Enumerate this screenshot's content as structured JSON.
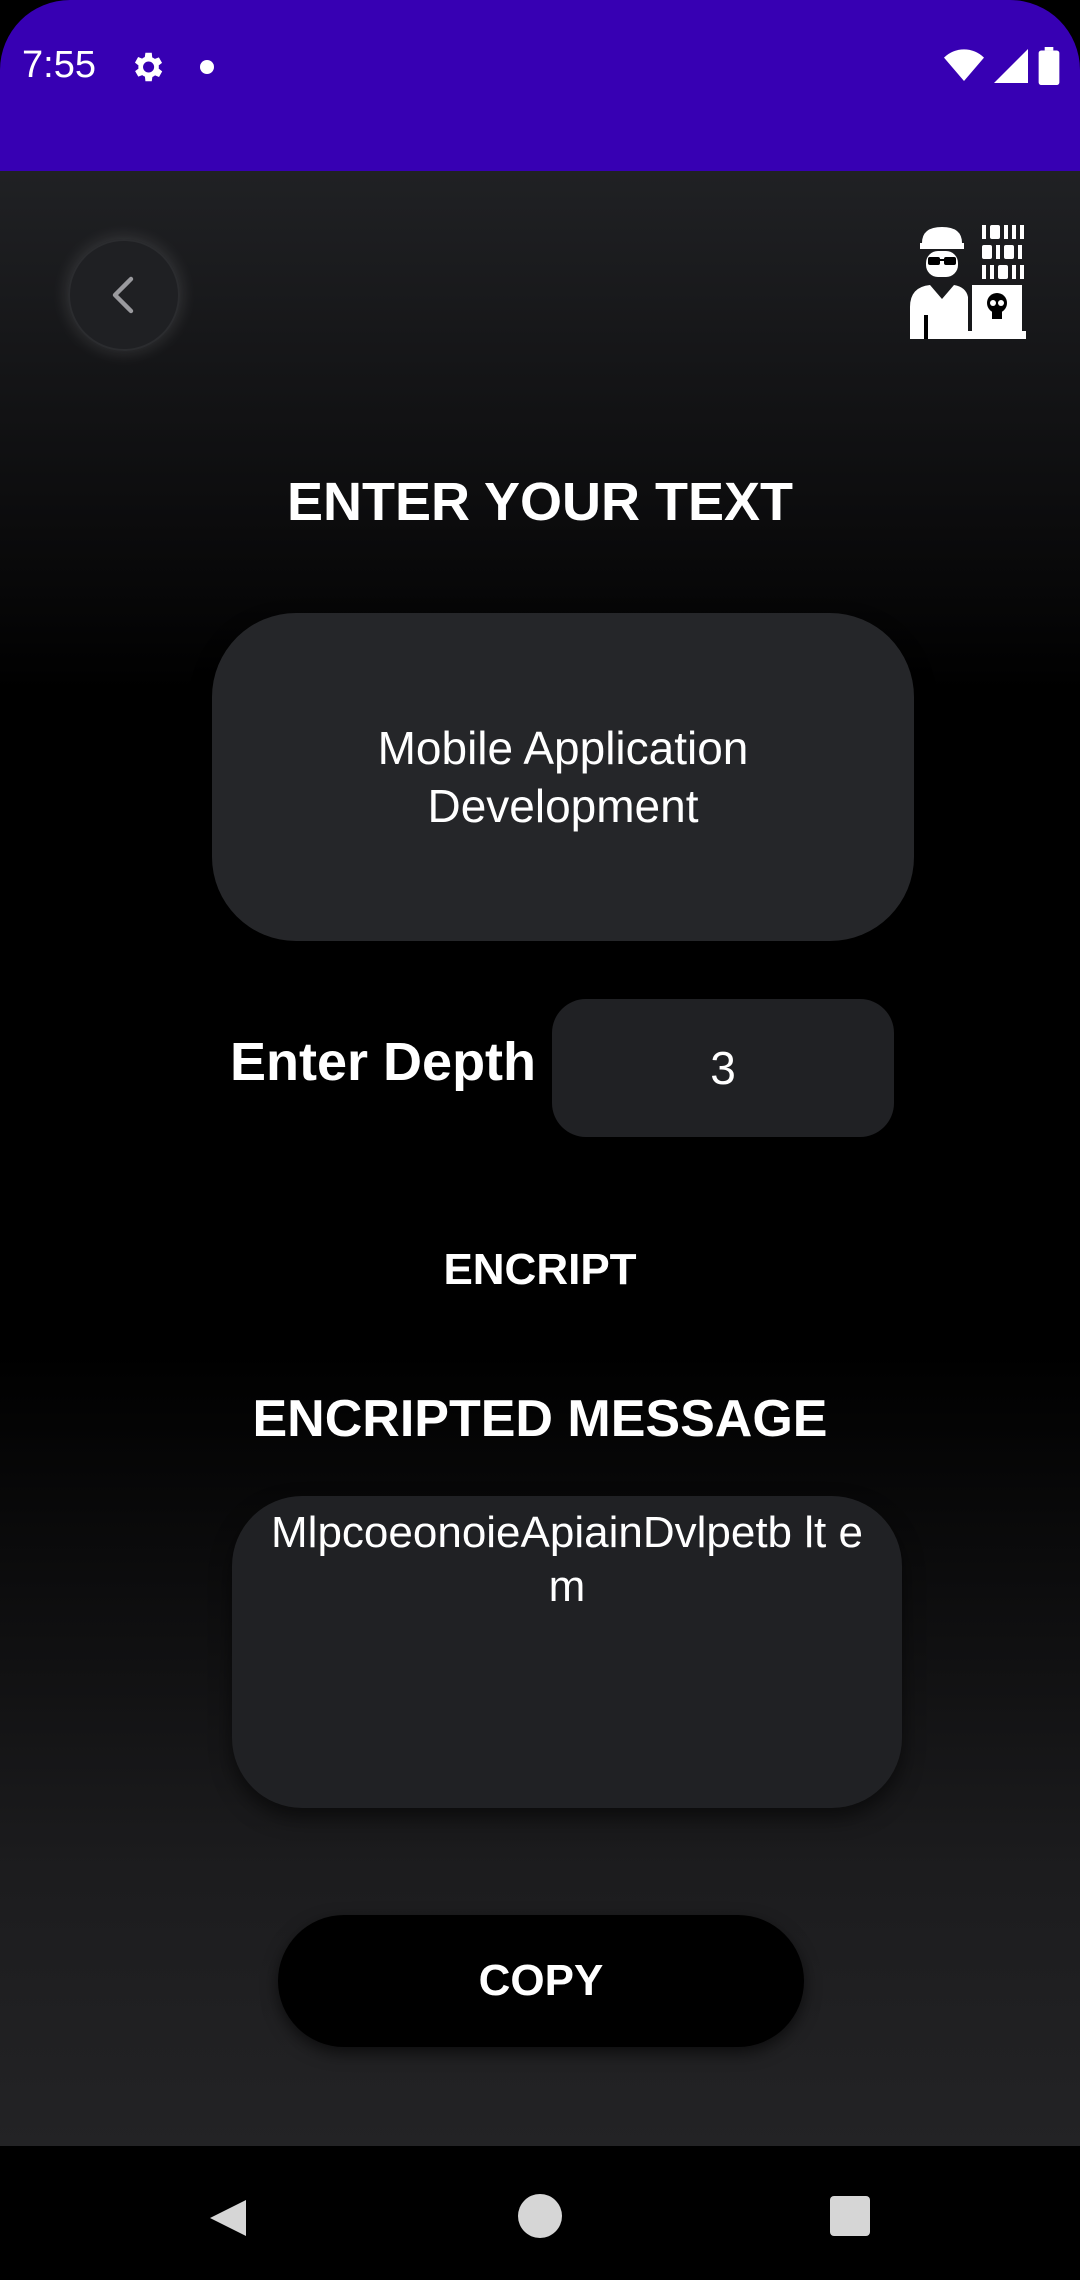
{
  "status_bar": {
    "time": "7:55",
    "background_color": "#3700b3",
    "icons": [
      "gear-icon",
      "notification-dot-icon",
      "wifi-icon",
      "signal-icon",
      "battery-icon"
    ]
  },
  "header": {
    "back_icon": "chevron-left-icon",
    "logo_icon": "hacker-computer-icon"
  },
  "main": {
    "enter_title": "ENTER YOUR TEXT",
    "input_text": "Mobile Application\nDevelopment",
    "depth_label": "Enter Depth",
    "depth_value": "3",
    "encrypt_label": "ENCRIPT",
    "encrypted_title": "ENCRIPTED MESSAGE",
    "encrypted_text": "MlpcoeonoieApiainDvlpetb lt em",
    "copy_label": "COPY"
  },
  "nav_bar": {
    "icons": [
      "nav-back-icon",
      "nav-home-icon",
      "nav-recents-icon"
    ]
  }
}
